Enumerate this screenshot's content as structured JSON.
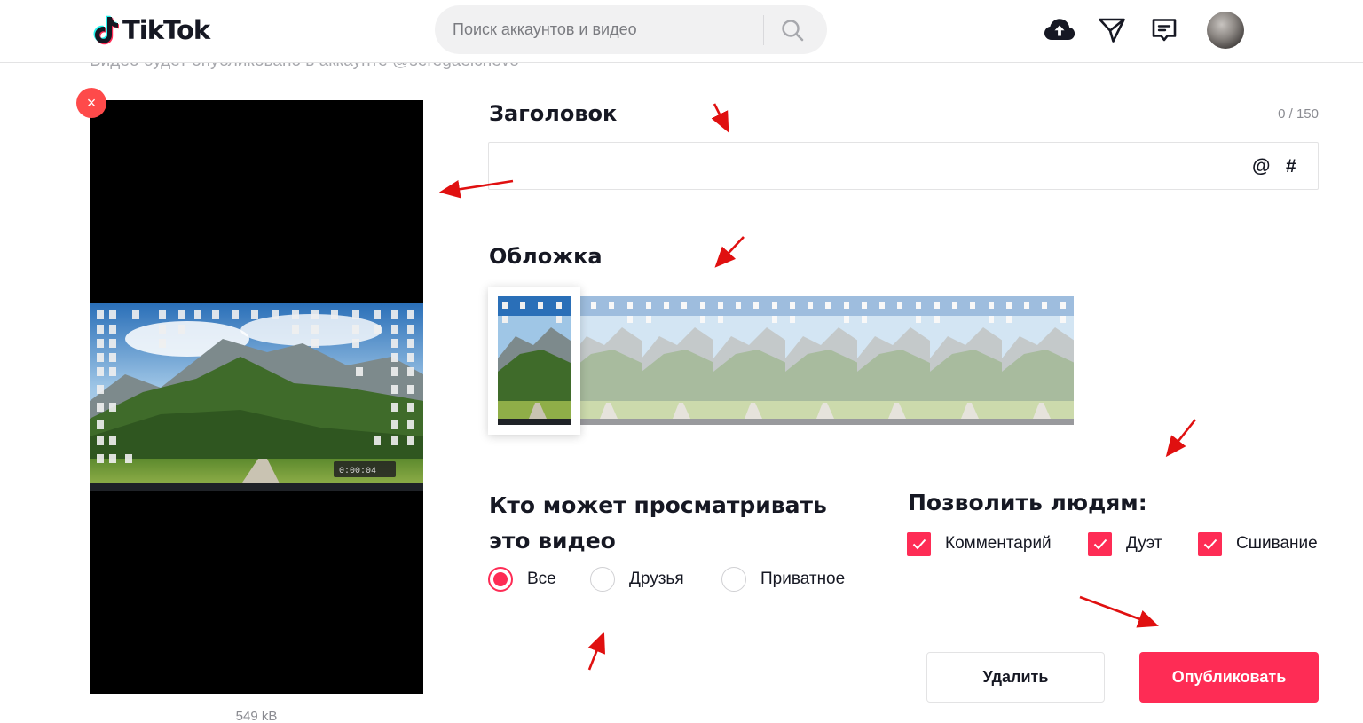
{
  "header": {
    "logo_text": "TikTok",
    "search_placeholder": "Поиск аккаунтов и видео",
    "icons": [
      "upload-cloud-icon",
      "send-icon",
      "inbox-message-icon"
    ]
  },
  "upload": {
    "subtitle": "Видео будет опубликовано в аккаунте @seregaelchevo",
    "file_size": "549 kB",
    "remove_symbol": "×",
    "video_timer": "0:00:04"
  },
  "caption": {
    "label": "Заголовок",
    "counter": "0 / 150",
    "value": "",
    "mention_symbol": "@",
    "hashtag_symbol": "#"
  },
  "cover": {
    "label": "Обложка",
    "thumbnail_count": 8,
    "selected_index": 0
  },
  "privacy": {
    "label": "Кто может просматривать это видео",
    "options": [
      {
        "label": "Все",
        "checked": true
      },
      {
        "label": "Друзья",
        "checked": false
      },
      {
        "label": "Приватное",
        "checked": false
      }
    ]
  },
  "allow": {
    "label": "Позволить людям:",
    "options": [
      {
        "label": "Комментарий",
        "checked": true
      },
      {
        "label": "Дуэт",
        "checked": true
      },
      {
        "label": "Сшивание",
        "checked": true
      }
    ]
  },
  "actions": {
    "delete_label": "Удалить",
    "publish_label": "Опубликовать"
  },
  "colors": {
    "accent": "#fe2c55",
    "annotation_arrow": "#e01010",
    "remove_button": "#fe4a4a"
  }
}
